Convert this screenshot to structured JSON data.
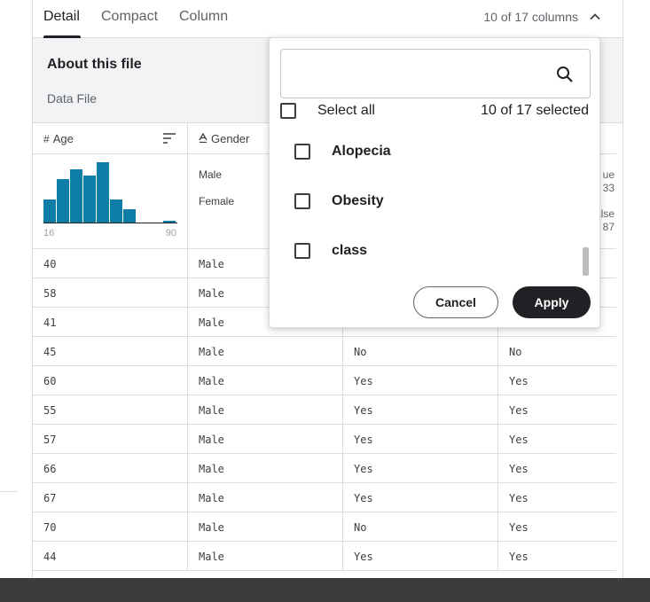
{
  "tabs": [
    {
      "label": "Detail",
      "active": true
    },
    {
      "label": "Compact",
      "active": false
    },
    {
      "label": "Column",
      "active": false
    }
  ],
  "column_count": "10 of 17 columns",
  "about": {
    "title": "About this file",
    "subtitle": "Data File"
  },
  "headers": {
    "age": {
      "type_icon": "#",
      "label": "Age"
    },
    "gender": {
      "type_icon": "A",
      "label": "Gender"
    }
  },
  "age_histogram": {
    "min_label": "16",
    "max_label": "90",
    "relative_heights": [
      0.38,
      0.72,
      0.88,
      0.78,
      1.0,
      0.38,
      0.22,
      0.0,
      0.0,
      0.03
    ],
    "bar_color": "#0e7ea6"
  },
  "gender_summary": [
    "Male",
    "Female"
  ],
  "side_summary": {
    "true_label": "ue",
    "true_count": "33",
    "false_label": "alse",
    "false_count": "87"
  },
  "rows": [
    [
      "40",
      "Male",
      "",
      ""
    ],
    [
      "58",
      "Male",
      "",
      ""
    ],
    [
      "41",
      "Male",
      "",
      ""
    ],
    [
      "45",
      "Male",
      "No",
      "No"
    ],
    [
      "60",
      "Male",
      "Yes",
      "Yes"
    ],
    [
      "55",
      "Male",
      "Yes",
      "Yes"
    ],
    [
      "57",
      "Male",
      "Yes",
      "Yes"
    ],
    [
      "66",
      "Male",
      "Yes",
      "Yes"
    ],
    [
      "67",
      "Male",
      "Yes",
      "Yes"
    ],
    [
      "70",
      "Male",
      "No",
      "Yes"
    ],
    [
      "44",
      "Male",
      "Yes",
      "Yes"
    ]
  ],
  "dropdown": {
    "search_placeholder": "",
    "select_all_label": "Select all",
    "selected_count": "10 of 17 selected",
    "options": [
      {
        "label": "Alopecia",
        "checked": false
      },
      {
        "label": "Obesity",
        "checked": false
      },
      {
        "label": "class",
        "checked": false
      }
    ],
    "cancel_label": "Cancel",
    "apply_label": "Apply"
  }
}
